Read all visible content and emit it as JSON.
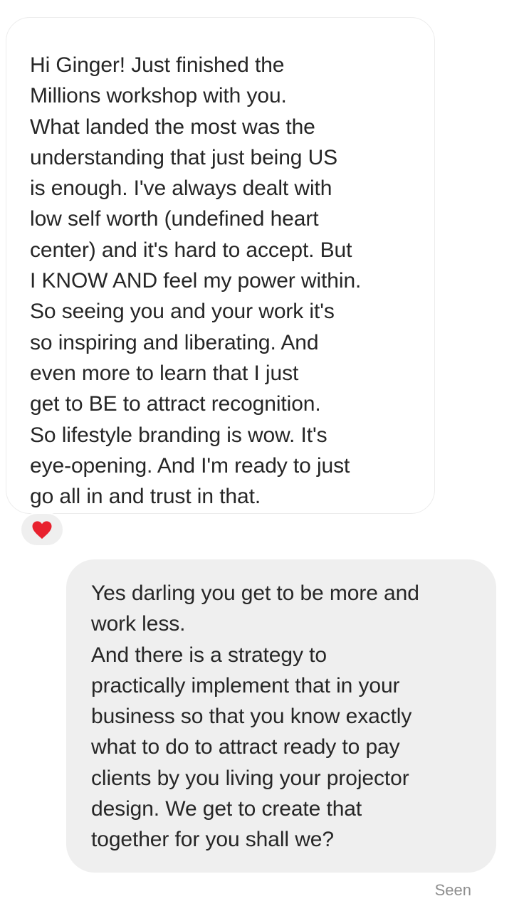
{
  "incoming_message": {
    "lines": [
      "Hi Ginger! Just finished the",
      "Millions workshop with you.",
      "What landed the most was the",
      "understanding that just being US",
      "is enough. I've always dealt with",
      "low self worth (undefined heart",
      "center) and it's hard to accept. But",
      "I KNOW AND feel my power within.",
      "So seeing you and your work it's",
      "so inspiring and liberating. And",
      "even more to learn that I just",
      "get to BE to attract recognition.",
      "So lifestyle branding is wow. It's",
      "eye-opening. And I'm ready to just",
      "go all in and trust in that."
    ],
    "reaction": {
      "icon": "heart-icon",
      "color": "#e8212e"
    }
  },
  "outgoing_message": {
    "lines": [
      "Yes darling you get to be more and",
      "work less.",
      "And there is a strategy to",
      "practically implement that in your",
      "business so that you know exactly",
      "what to do to attract ready to pay",
      "clients by you living your projector",
      "design. We get to create that",
      "together for you shall we?"
    ]
  },
  "status": {
    "seen_label": "Seen"
  },
  "colors": {
    "incoming_bubble": "#ffffff",
    "incoming_border": "#ececec",
    "outgoing_bubble": "#efefef",
    "text": "#262626",
    "muted": "#8e8e8e"
  }
}
